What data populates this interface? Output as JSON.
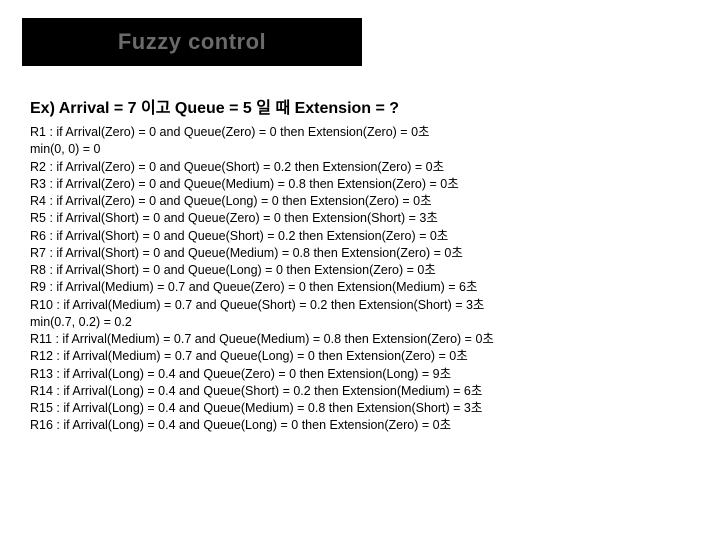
{
  "title": "Fuzzy control",
  "example_heading": "Ex) Arrival = 7 이고 Queue = 5 일 때 Extension = ?",
  "rules": [
    "R1  : if Arrival(Zero) = 0 and Queue(Zero) = 0 then Extension(Zero) = 0초",
    "        min(0, 0) = 0",
    "R2  : if Arrival(Zero) = 0 and Queue(Short) = 0.2 then Extension(Zero) = 0초",
    "R3  : if Arrival(Zero) = 0 and Queue(Medium) = 0.8 then Extension(Zero) = 0초",
    "R4  : if Arrival(Zero) = 0 and Queue(Long) = 0 then Extension(Zero) = 0초",
    "R5  : if Arrival(Short) = 0 and Queue(Zero) = 0 then Extension(Short) = 3초",
    "R6  : if Arrival(Short) = 0 and Queue(Short) = 0.2 then Extension(Zero) = 0초",
    "R7  : if Arrival(Short) = 0 and Queue(Medium) = 0.8 then Extension(Zero) = 0초",
    "R8  : if Arrival(Short) = 0 and Queue(Long) = 0 then Extension(Zero) = 0초",
    "R9  : if Arrival(Medium) = 0.7 and Queue(Zero) = 0 then Extension(Medium) = 6초",
    "R10 : if Arrival(Medium) = 0.7 and Queue(Short) = 0.2 then Extension(Short) = 3초",
    "         min(0.7, 0.2) = 0.2",
    "R11 : if Arrival(Medium) = 0.7 and Queue(Medium) = 0.8 then Extension(Zero) = 0초",
    "R12 : if Arrival(Medium) = 0.7 and Queue(Long) = 0 then Extension(Zero) = 0초",
    "R13 : if Arrival(Long) = 0.4 and Queue(Zero) = 0 then Extension(Long) = 9초",
    "R14 : if Arrival(Long) = 0.4 and Queue(Short) = 0.2 then Extension(Medium) = 6초",
    "R15 : if Arrival(Long) = 0.4 and Queue(Medium) = 0.8 then Extension(Short) = 3초",
    "R16 : if Arrival(Long) = 0.4 and Queue(Long) = 0 then Extension(Zero) = 0초"
  ]
}
